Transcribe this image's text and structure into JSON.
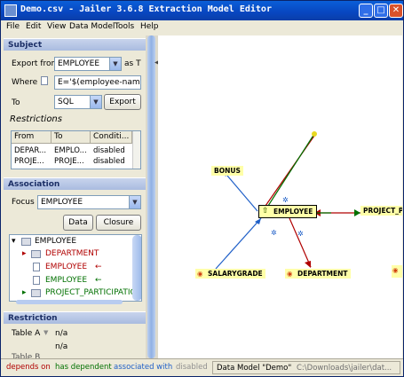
{
  "window": {
    "title": "Demo.csv - Jailer 3.6.8 Extraction Model Editor",
    "minimize": "_",
    "maximize": "□",
    "close": "✕"
  },
  "menu": [
    "File",
    "Edit",
    "View",
    "Data Model",
    "Tools",
    "Help"
  ],
  "subject": {
    "header": "Subject",
    "export_from_label": "Export from",
    "export_from_value": "EMPLOYEE",
    "as_suffix": "as T",
    "where_label": "Where",
    "where_value": "E='$(employee-name)'",
    "to_label": "To",
    "to_value": "SQL",
    "export_button": "Export"
  },
  "restrictions": {
    "title": "Restrictions",
    "columns": [
      "From",
      "To",
      "Conditi..."
    ],
    "rows": [
      [
        "DEPAR...",
        "EMPLO...",
        "disabled"
      ],
      [
        "PROJE...",
        "PROJE...",
        "disabled"
      ]
    ]
  },
  "association": {
    "header": "Association",
    "focus_label": "Focus",
    "focus_value": "EMPLOYEE",
    "data_button": "Data",
    "closure_button": "Closure",
    "tree": [
      {
        "label": "EMPLOYEE",
        "color": "#000000",
        "indent": 0,
        "expander": "▾",
        "arrow": ""
      },
      {
        "label": "DEPARTMENT",
        "color": "#b00000",
        "indent": 1,
        "expander": "▸",
        "arrow": ""
      },
      {
        "label": "EMPLOYEE",
        "color": "#b00000",
        "indent": 1,
        "expander": "",
        "arrow": "←"
      },
      {
        "label": "EMPLOYEE",
        "color": "#007000",
        "indent": 1,
        "expander": "",
        "arrow": "←"
      },
      {
        "label": "PROJECT_PARTICIPATION",
        "color": "#007000",
        "indent": 1,
        "expander": "▸",
        "arrow": ""
      }
    ]
  },
  "restriction": {
    "header": "Restriction",
    "table_a_label": "Table A",
    "table_a_value": "n/a",
    "table_b_value": "n/a",
    "truncated_label": "Table B"
  },
  "graph": {
    "nodes": {
      "bonus": "BONUS",
      "employee": "EMPLOYEE",
      "project": "PROJECT_P",
      "salarygrade": "SALARYGRADE",
      "department": "DEPARTMENT"
    }
  },
  "status": {
    "depends_on": "depends on",
    "has_dependent": "has dependent",
    "associated_with": "associated with",
    "disabled": "disabled",
    "data_model_label": "Data Model \"Demo\"",
    "path": "C:\\Downloads\\jailer\\dat..."
  },
  "colors": {
    "depends_on": "#b00000",
    "has_dependent": "#007000",
    "associated_with": "#2060c8",
    "disabled": "#909090"
  }
}
